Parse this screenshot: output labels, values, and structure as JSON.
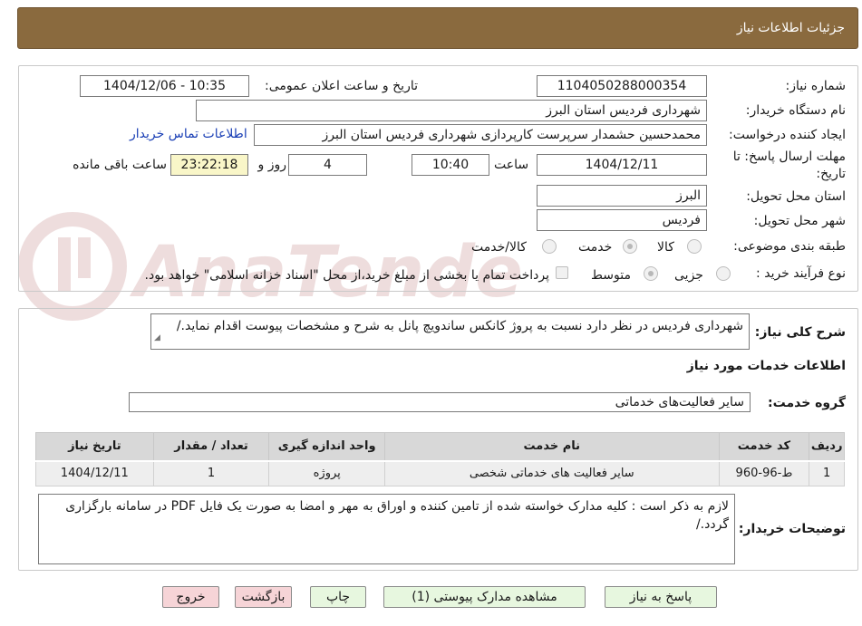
{
  "header": {
    "title": "جزئیات اطلاعات نیاز"
  },
  "form": {
    "need_number": {
      "label": "شماره نیاز:",
      "value": "1104050288000354"
    },
    "announce": {
      "label": "تاریخ و ساعت اعلان عمومی:",
      "value": "1404/12/06 - 10:35"
    },
    "buyer_org": {
      "label": "نام دستگاه خریدار:",
      "value": "شهرداری فردیس استان البرز"
    },
    "requester": {
      "label": "ایجاد کننده درخواست:",
      "value": "محمدحسین حشمدار سرپرست کارپردازی شهرداری فردیس استان البرز",
      "contact_link": "اطلاعات تماس خریدار"
    },
    "deadline": {
      "label_line1": "مهلت ارسال پاسخ: تا",
      "label_line2": "تاریخ:",
      "date": "1404/12/11",
      "time_label": "ساعت",
      "time": "10:40",
      "days": "4",
      "days_label": "روز و",
      "remaining": "23:22:18",
      "remaining_label": "ساعت باقی مانده"
    },
    "province": {
      "label": "استان محل تحویل:",
      "value": "البرز"
    },
    "city": {
      "label": "شهر محل تحویل:",
      "value": "فردیس"
    },
    "category": {
      "label": "طبقه بندی موضوعی:",
      "options": [
        "کالا",
        "خدمت",
        "کالا/خدمت"
      ],
      "selected": "خدمت"
    },
    "process": {
      "label": "نوع فرآیند خرید :",
      "options": [
        "جزیی",
        "متوسط"
      ],
      "selected": "متوسط",
      "checkbox_text": "پرداخت تمام یا بخشی از مبلغ خرید،از محل \"اسناد خزانه اسلامی\" خواهد بود."
    }
  },
  "description": {
    "label": "شرح کلی نیاز:",
    "value": "شهرداری فردیس در نظر دارد نسبت به پروژ کانکس ساندویچ پانل به شرح و مشخصات پیوست اقدام نماید./"
  },
  "services": {
    "title": "اطلاعات خدمات مورد نیاز",
    "group_label": "گروه خدمت:",
    "group_value": "سایر فعالیت‌های خدماتی",
    "columns": [
      "ردیف",
      "کد خدمت",
      "نام خدمت",
      "واحد اندازه گیری",
      "تعداد / مقدار",
      "تاریخ نیاز"
    ],
    "rows": [
      [
        "1",
        "ط-96-960",
        "سایر فعالیت های خدماتی شخصی",
        "پروژه",
        "1",
        "1404/12/11"
      ]
    ]
  },
  "buyer_notes": {
    "label": "توضیحات خریدار:",
    "value": "لازم به ذکر است : کلیه مدارک خواسته شده از تامین کننده و اوراق به مهر و امضا به صورت یک فایل PDF در سامانه بارگزاری گردد./"
  },
  "buttons": {
    "reply": "پاسخ به نیاز",
    "attachments": "مشاهده مدارک پیوستی (1)",
    "print": "چاپ",
    "back": "بازگشت",
    "exit": "خروج"
  },
  "watermark": {
    "text": "AnaTender.neT"
  },
  "colors": {
    "header_bg": "#8a6a3e",
    "remaining_bg": "#f9f6c8",
    "button_green": "#e7f7df",
    "button_red": "#f6d4d7",
    "link": "#1a3fb5"
  }
}
